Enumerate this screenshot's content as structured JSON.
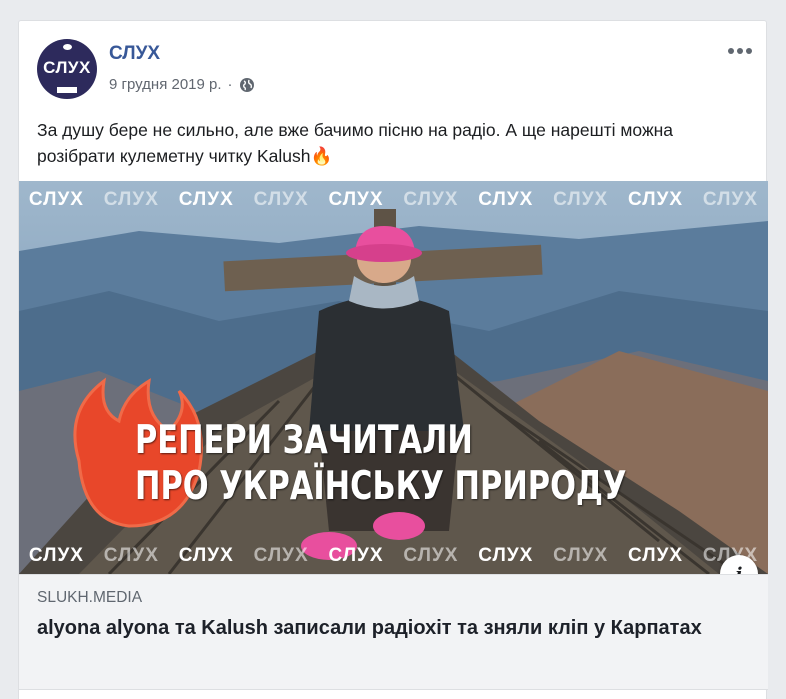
{
  "post": {
    "page_name": "СЛУХ",
    "avatar_text": "СЛУХ",
    "date": "9 грудня 2019 р.",
    "separator": "·",
    "privacy_icon": "globe-icon",
    "text": "За душу бере не сильно, але вже бачимо пісню на радіо. А ще нарешті можна розібрати кулеметну читку Kalush🔥"
  },
  "image": {
    "watermark": "СЛУХ",
    "headline_line1": "РЕПЕРИ ЗАЧИТАЛИ",
    "headline_line2": "ПРО УКРАЇНСЬКУ ПРИРОДУ",
    "info_label": "i"
  },
  "link": {
    "domain": "slukh.media",
    "title": "alyona alyona та Kalush записали радіохіт та зняли кліп у Карпатах"
  },
  "colors": {
    "page_name": "#385898",
    "avatar_bg": "#2d2a5c",
    "link_bg": "#f2f3f5",
    "accent_fire": "#e8472a",
    "hat_pink": "#e84f9e"
  }
}
